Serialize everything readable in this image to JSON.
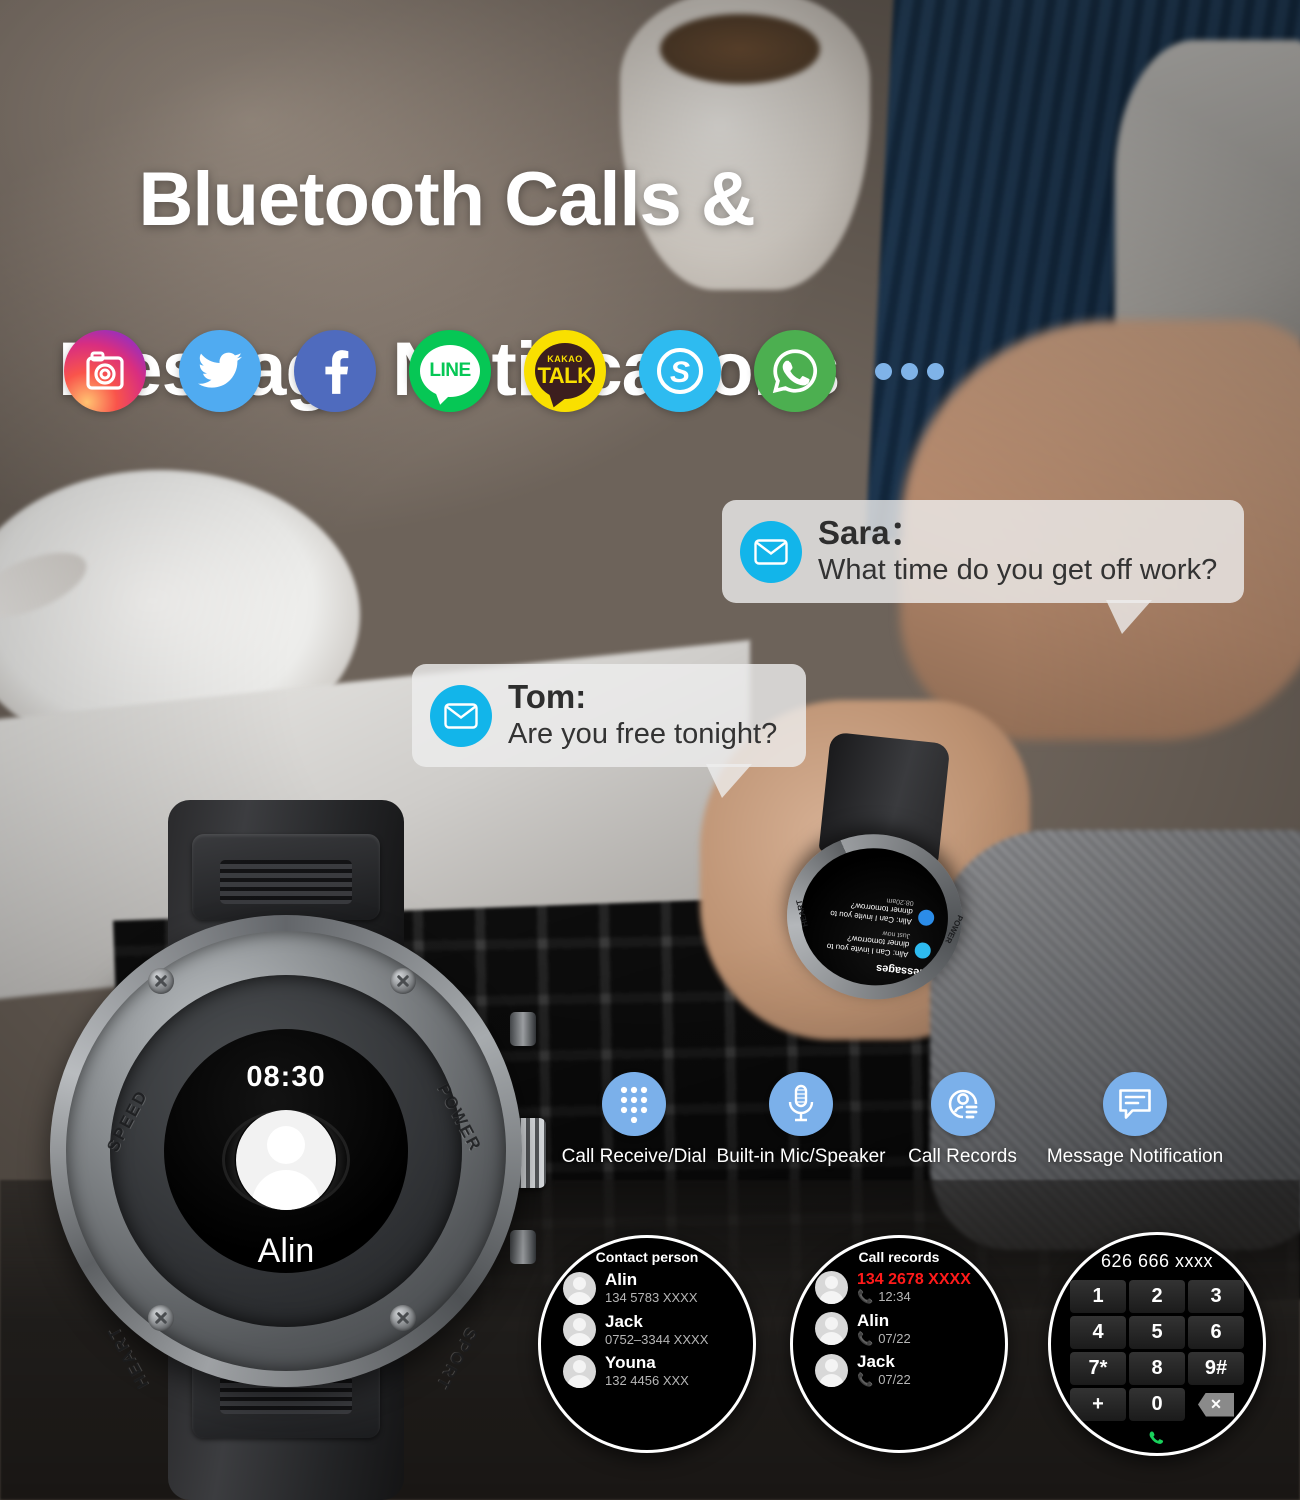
{
  "headline": {
    "line1": "Bluetooth Calls &",
    "line2": "Message Notifications"
  },
  "apps": {
    "items": [
      {
        "name": "instagram",
        "icon": "instagram-icon",
        "color": "#D92E7F"
      },
      {
        "name": "twitter",
        "icon": "twitter-icon",
        "color": "#50ABF1"
      },
      {
        "name": "facebook",
        "icon": "facebook-icon",
        "color": "#4F6BBE"
      },
      {
        "name": "line",
        "icon": "line-icon",
        "label": "LINE",
        "color": "#06C755"
      },
      {
        "name": "kakaotalk",
        "icon": "kakaotalk-icon",
        "label_top": "KAKAO",
        "label_main": "TALK",
        "color": "#F9E000"
      },
      {
        "name": "skype",
        "icon": "skype-icon",
        "label": "S",
        "color": "#2EBBF0"
      },
      {
        "name": "whatsapp",
        "icon": "whatsapp-icon",
        "color": "#4CAF50"
      },
      {
        "name": "more",
        "icon": "more-dots-icon",
        "color": "#7FB3E8"
      }
    ]
  },
  "notifications": [
    {
      "id": "sara",
      "icon": "envelope-icon",
      "name": "Sara：",
      "message": "What time do you get off work?",
      "accent": "#12B5EA"
    },
    {
      "id": "tom",
      "icon": "envelope-icon",
      "name": "Tom:",
      "message": "Are you free tonight?",
      "accent": "#12B5EA"
    }
  ],
  "big_watch": {
    "time": "08:30",
    "caller_name": "Alin",
    "decline_label": "decline-call",
    "accept_label": "accept-call",
    "bezel_words": {
      "top_left": "SPEED",
      "top_right": "POWER",
      "bottom_left": "HEART",
      "bottom_right": "SPORT"
    },
    "decline_color": "#F02A4B",
    "accept_color": "#17CE5E"
  },
  "wrist_watch": {
    "title": "Messages",
    "items": [
      {
        "time": "Just now",
        "text": "Alin: Can I invite you to dinner tomorrow?"
      },
      {
        "time": "08:20am",
        "text": "Alin: Can I invite you to dinner tomorrow?"
      }
    ],
    "bezel_words": {
      "left": "POWER",
      "right": "HEART"
    }
  },
  "features": [
    {
      "icon": "dialpad-icon",
      "label": "Call Receive/Dial"
    },
    {
      "icon": "microphone-icon",
      "label": "Built-in Mic/Speaker"
    },
    {
      "icon": "contact-record-icon",
      "label": "Call Records"
    },
    {
      "icon": "message-bubble-icon",
      "label": "Message Notification"
    }
  ],
  "mini_screens": {
    "contacts": {
      "title": "Contact person",
      "rows": [
        {
          "name": "Alin",
          "number": "134 5783 XXXX"
        },
        {
          "name": "Jack",
          "number": "0752–3344 XXXX"
        },
        {
          "name": "Youna",
          "number": "132 4456 XXX"
        }
      ]
    },
    "records": {
      "title": "Call records",
      "rows": [
        {
          "name": "134 2678 XXXX",
          "missed": true,
          "time": "12:34"
        },
        {
          "name": "Alin",
          "missed": false,
          "time": "07/22"
        },
        {
          "name": "Jack",
          "missed": false,
          "time": "07/22"
        }
      ]
    },
    "dialer": {
      "number": "626 666 xxxx",
      "keys": [
        "1",
        "2",
        "3",
        "4",
        "5",
        "6",
        "7*",
        "8",
        "9#",
        "+",
        "0",
        "del"
      ],
      "call_icon": "phone-icon"
    }
  }
}
